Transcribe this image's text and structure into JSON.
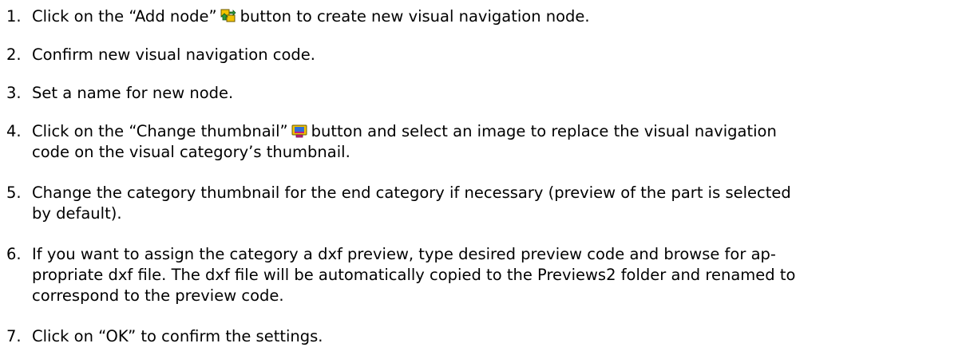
{
  "steps": [
    {
      "number": "1.",
      "before_icon": "Click on the “Add node”",
      "icon": "add-node-icon",
      "after_icon": "button to create new visual navigation node."
    },
    {
      "number": "2.",
      "text": "Confirm new visual navigation code."
    },
    {
      "number": "3.",
      "text": "Set a name for new node."
    },
    {
      "number": "4.",
      "before_icon": "Click on the “Change thumbnail”",
      "icon": "change-thumbnail-icon",
      "after_icon_line1": "button and select an image to replace the visual navigation",
      "line2": "code on the visual category’s thumbnail."
    },
    {
      "number": "5.",
      "line1": "Change the category thumbnail for the end category if necessary (preview of the part is selected",
      "line2": "by default)."
    },
    {
      "number": "6.",
      "line1": "If you want to assign the category a dxf preview, type desired preview code and browse for ap-",
      "line2": "propriate dxf file. The dxf file will be automatically copied to the Previews2 folder and renamed to",
      "line3": "correspond to the preview code."
    },
    {
      "number": "7.",
      "text": "Click on “OK” to confirm the settings."
    }
  ],
  "colors": {
    "text": "#000000",
    "icon_yellow": "#f2c200",
    "icon_green": "#2e9a3a",
    "icon_blue": "#2f6fd6",
    "icon_magenta": "#c2207c"
  }
}
